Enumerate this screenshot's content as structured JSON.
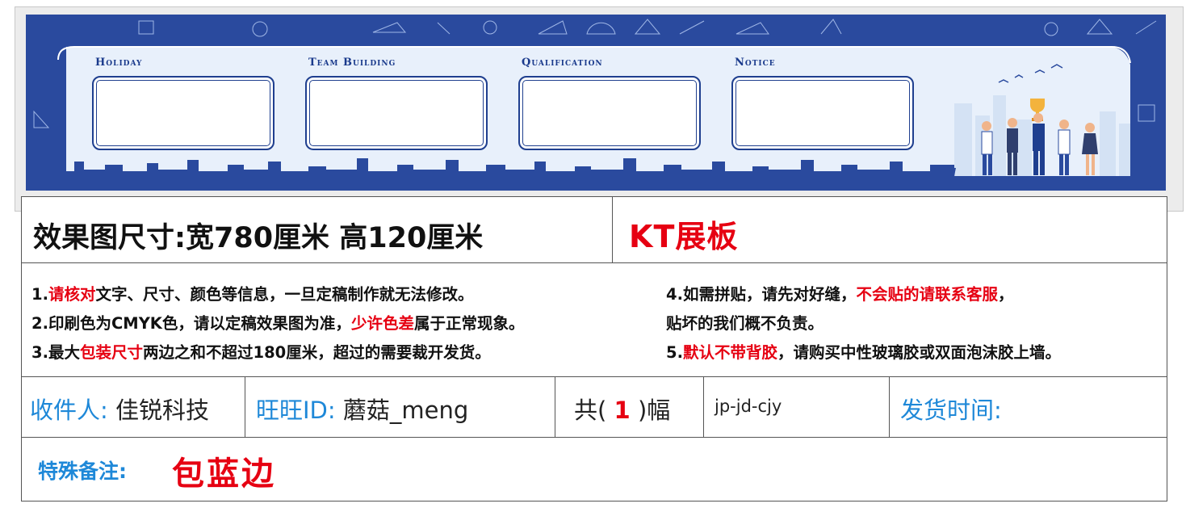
{
  "banner": {
    "panels": [
      {
        "title": "Holiday"
      },
      {
        "title": "Team Building"
      },
      {
        "title": "Qualification"
      },
      {
        "title": "Notice"
      }
    ],
    "colors": {
      "primary": "#2a4a9e",
      "light": "#e8f0fb",
      "frame": "#1f3f8f"
    }
  },
  "spec": {
    "size_text": "效果图尺寸:宽780厘米  高120厘米",
    "material": "KT展板"
  },
  "notes": {
    "left": [
      [
        {
          "t": "1.",
          "red": false
        },
        {
          "t": "请核对",
          "red": true
        },
        {
          "t": "文字、尺寸、颜色等信息，一旦定稿制作就无法修改。",
          "red": false
        }
      ],
      [
        {
          "t": "2.印刷色为CMYK色，请以定稿效果图为准，",
          "red": false
        },
        {
          "t": "少许色差",
          "red": true
        },
        {
          "t": "属于正常现象。",
          "red": false
        }
      ],
      [
        {
          "t": "3.最大",
          "red": false
        },
        {
          "t": "包装尺寸",
          "red": true
        },
        {
          "t": "两边之和不超过180厘米，超过的需要裁开发货。",
          "red": false
        }
      ]
    ],
    "right": [
      [
        {
          "t": "4.如需拼贴，请先对好缝，",
          "red": false
        },
        {
          "t": "不会贴的请联系客服",
          "red": true
        },
        {
          "t": "，",
          "red": false
        }
      ],
      [
        {
          "t": "   贴坏的我们概不负责。",
          "red": false
        }
      ],
      [
        {
          "t": "5.",
          "red": false
        },
        {
          "t": "默认不带背胶",
          "red": true
        },
        {
          "t": "，请购买中性玻璃胶或双面泡沫胶上墙。",
          "red": false
        }
      ]
    ]
  },
  "order": {
    "recipient_label": "收件人:",
    "recipient_value": "佳锐科技",
    "wangwang_label": "旺旺ID:",
    "wangwang_value": "蘑菇_meng",
    "count_prefix": "共(",
    "count_value": "1",
    "count_suffix": ")幅",
    "code": "jp-jd-cjy",
    "ship_time_label": "发货时间:"
  },
  "remark": {
    "label": "特殊备注:",
    "value": "包蓝边"
  }
}
